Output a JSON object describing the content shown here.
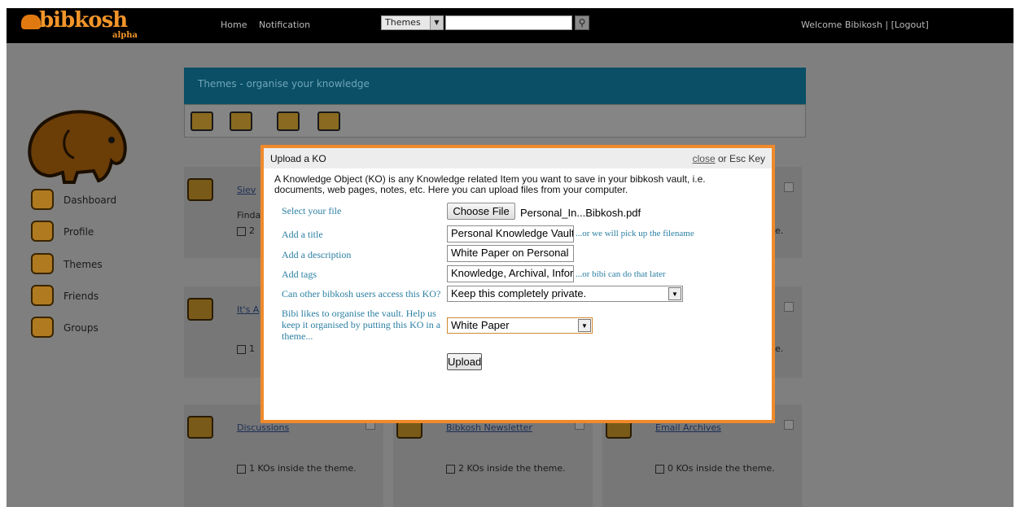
{
  "header": {
    "logo_text": "bibkosh",
    "logo_tag": "alpha",
    "nav": [
      "Home",
      "Notification"
    ],
    "search_scope": "Themes",
    "search_placeholder": "",
    "welcome": "Welcome Bibikosh | [Logout]"
  },
  "sidebar": {
    "items": [
      {
        "label": "Dashboard",
        "icon": "home-icon"
      },
      {
        "label": "Profile",
        "icon": "profile-icon"
      },
      {
        "label": "Themes",
        "icon": "themes-icon"
      },
      {
        "label": "Friends",
        "icon": "friends-icon"
      },
      {
        "label": "Groups",
        "icon": "groups-icon"
      }
    ]
  },
  "themes_panel": {
    "title": "Themes - organise your knowledge",
    "toolbar_icons": [
      "open-folder-icon",
      "new-folder-icon",
      "share-folder-icon",
      "delete-folder-icon"
    ]
  },
  "cards": [
    {
      "name": "Siev",
      "desc": "Finda",
      "kos": "2"
    },
    {
      "name": "It's A",
      "desc": "",
      "kos": "1"
    },
    {
      "name": "Discussions",
      "desc": "",
      "kos": "1 KOs inside the theme."
    },
    {
      "name": "Bibkosh Newsletter",
      "desc": "",
      "kos": "2 KOs inside the theme."
    },
    {
      "name": "Email Archives",
      "desc": "",
      "kos": "0 KOs inside the theme."
    }
  ],
  "cards_partial_right": [
    "e.",
    "e."
  ],
  "dialog": {
    "title": "Upload a KO",
    "close_link": "close",
    "close_suffix": " or Esc Key",
    "description": "A Knowledge Object (KO) is any Knowledge related Item you want to save in your bibkosh vault, i.e. documents, web pages, notes, etc. Here you can upload files from your computer.",
    "fields": {
      "file_label": "Select your file",
      "file_button": "Choose File",
      "file_name": "Personal_In...Bibkosh.pdf",
      "title_label": "Add a title",
      "title_value": "Personal Knowledge Vault",
      "title_hint": "...or we will pick up the filename",
      "desc_label": "Add a description",
      "desc_value": "White Paper on Personal",
      "tags_label": "Add tags",
      "tags_value": "Knowledge, Archival, Infor",
      "tags_hint": "...or bibi can do that later",
      "access_label": "Can other bibkosh users access this KO?",
      "access_value": "Keep this completely private.",
      "theme_label": "Bibi likes to organise the vault. Help us keep it organised by putting this KO in a theme...",
      "theme_value": "White Paper"
    },
    "upload_button": "Upload"
  }
}
